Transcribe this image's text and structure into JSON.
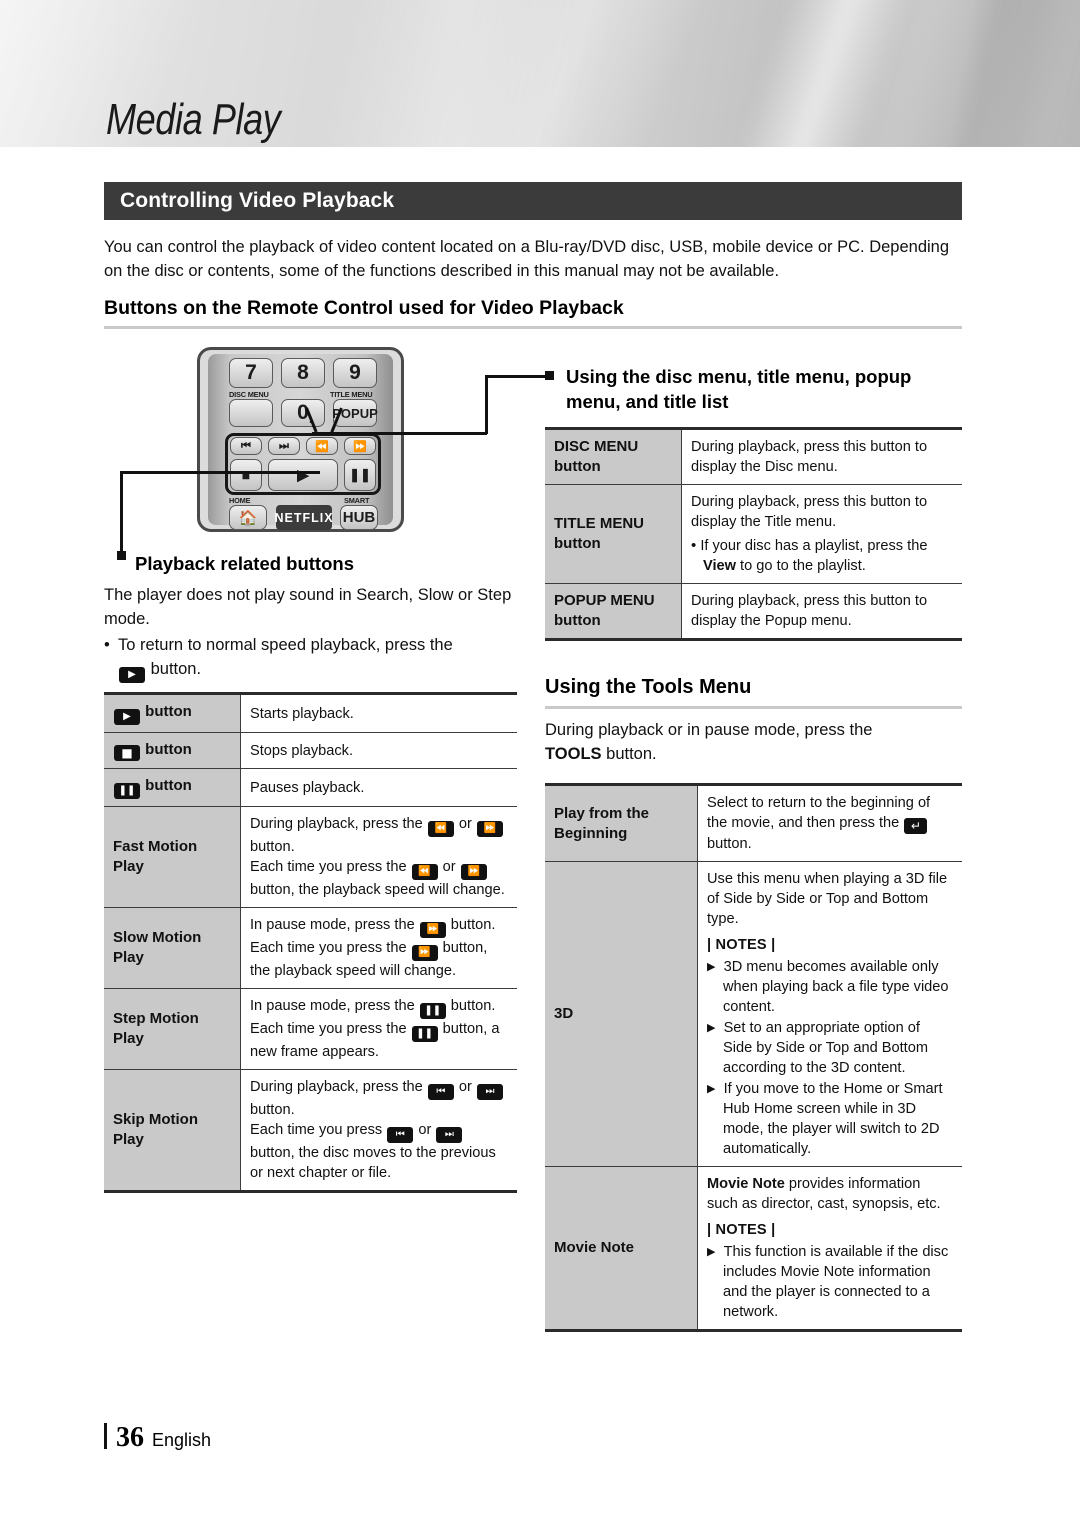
{
  "header": {
    "chapter_title": "Media Play"
  },
  "section": {
    "title": "Controlling Video Playback"
  },
  "intro": "You can control the playback of video content located on a Blu-ray/DVD disc, USB, mobile device or PC. Depending on the disc or contents, some of the functions described in this manual may not be available.",
  "subheading": "Buttons on the Remote Control used for Video Playback",
  "remote": {
    "keys": {
      "seven": "7",
      "eight": "8",
      "nine": "9",
      "zero": "0",
      "popup": "POPUP",
      "hub": "HUB",
      "netflix": "NETFLIX"
    },
    "labels": {
      "disc_menu": "DISC MENU",
      "title_menu": "TITLE MENU",
      "home": "HOME",
      "smart": "SMART"
    }
  },
  "callouts": {
    "playback_related": "Playback related buttons",
    "disc_title_popup": "Using the disc menu, title menu, popup menu, and title list"
  },
  "playback_note": {
    "line1": "The player does not play sound in Search, Slow or Step mode.",
    "bullet_pre": "To return to normal speed playback, press the",
    "bullet_post": "button."
  },
  "playback_table": [
    {
      "key_icon": "play",
      "key_label": "button",
      "value": "Starts playback."
    },
    {
      "key_icon": "stop",
      "key_label": "button",
      "value": "Stops playback."
    },
    {
      "key_icon": "pause",
      "key_label": "button",
      "value": "Pauses playback."
    },
    {
      "key_label": "Fast Motion Play",
      "lines": [
        "During playback, press the [rew] or [ff] button.",
        "Each time you press the [rew] or [ff] button, the playback speed will change."
      ]
    },
    {
      "key_label": "Slow Motion Play",
      "lines": [
        "In pause mode, press the [ff] button.",
        "Each time you press the [ff] button, the playback speed will change."
      ]
    },
    {
      "key_label": "Step Motion Play",
      "lines": [
        "In pause mode, press the [pause] button.",
        "Each time you press the [pause] button, a new frame appears."
      ]
    },
    {
      "key_label": "Skip Motion Play",
      "lines": [
        "During playback, press the [prev] or [next] button.",
        "Each time you press [prev] or [next] button, the disc moves to the previous or next chapter or file."
      ]
    }
  ],
  "menu_table": [
    {
      "key_label": "DISC MENU button",
      "value": "During playback, press this button to display the Disc menu."
    },
    {
      "key_label": "TITLE MENU button",
      "value": "During playback, press this button to display the Title menu.",
      "bullet": "If your disc has a playlist, press the View to go to the playlist.",
      "bullet_bold": "View"
    },
    {
      "key_label": "POPUP MENU button",
      "value": "During playback, press this button to display the Popup menu."
    }
  ],
  "tools": {
    "heading": "Using the Tools Menu",
    "intro_pre": "During playback or in pause mode, press the",
    "intro_bold": "TOOLS",
    "intro_post": "button."
  },
  "tools_table": [
    {
      "key_label": "Play from the Beginning",
      "value_pre": "Select to return to the beginning of the movie, and then press the",
      "value_post": "button."
    },
    {
      "key_label": "3D",
      "value": "Use this menu when playing a 3D file of Side by Side or Top and Bottom type.",
      "notes_label": "| NOTES |",
      "notes": [
        "3D menu becomes available only when playing back a file type video content.",
        "Set to an appropriate option of Side by Side or Top and Bottom according to the 3D content.",
        "If you move to the Home or Smart Hub Home screen while in 3D mode, the player will switch to 2D automatically."
      ]
    },
    {
      "key_label": "Movie Note",
      "value_bold": "Movie Note",
      "value": " provides information such as director, cast, synopsis, etc.",
      "notes_label": "| NOTES |",
      "notes": [
        "This function is available if the disc includes Movie Note information and the player is connected to a network."
      ]
    }
  ],
  "footer": {
    "page_number": "36",
    "language": "English"
  }
}
